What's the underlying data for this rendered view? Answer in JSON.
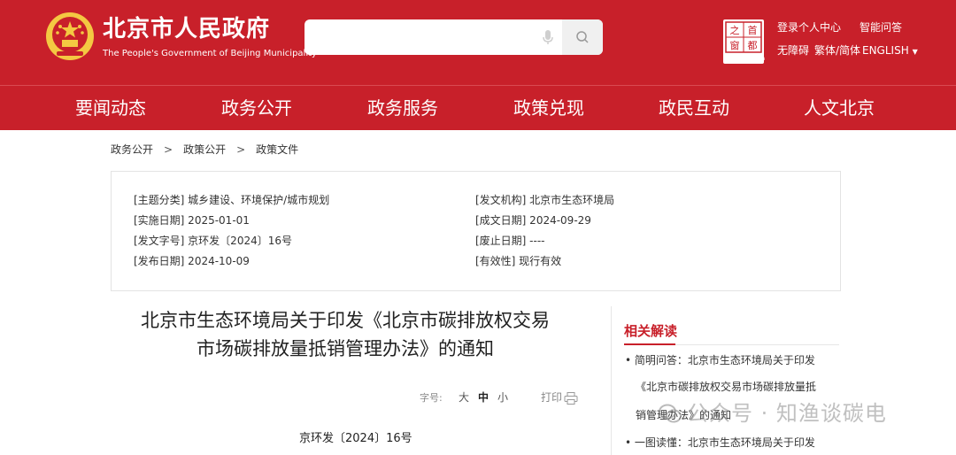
{
  "header": {
    "site_title": "北京市人民政府",
    "site_subtitle": "The People's Government of Beijing Municipality",
    "search_placeholder": "",
    "logo_chars": [
      "首",
      "都",
      "之",
      "窗"
    ],
    "logo_caption": "Beijing-China",
    "links": {
      "login": "登录个人中心",
      "smart_qa": "智能问答",
      "accessible": "无障碍",
      "traditional": "繁体/简体",
      "english": "ENGLISH"
    }
  },
  "nav": [
    "要闻动态",
    "政务公开",
    "政务服务",
    "政策兑现",
    "政民互动",
    "人文北京"
  ],
  "breadcrumb": [
    "政务公开",
    "政策公开",
    "政策文件"
  ],
  "meta": {
    "topic": "[主题分类] 城乡建设、环境保护/城市规划",
    "issuer": "[发文机构] 北京市生态环境局",
    "effective_date": "[实施日期] 2025-01-01",
    "created_date": "[成文日期] 2024-09-29",
    "doc_number": "[发文字号] 京环发〔2024〕16号",
    "repeal_date": "[废止日期] ----",
    "publish_date": "[发布日期] 2024-10-09",
    "validity": "[有效性] 现行有效"
  },
  "article": {
    "title_line1": "北京市生态环境局关于印发《北京市碳排放权交易",
    "title_line2": "市场碳排放量抵销管理办法》的通知",
    "font_size_label": "字号:",
    "font_sizes": [
      "大",
      "中",
      "小"
    ],
    "print_label": "打印",
    "doc_number": "京环发〔2024〕16号"
  },
  "related": {
    "heading": "相关解读",
    "items": [
      "• 简明问答：北京市生态环境局关于印发",
      "《北京市碳排放权交易市场碳排放量抵",
      "销管理办法》的通知",
      "• 一图读懂：北京市生态环境局关于印发"
    ]
  },
  "watermark": "公众号 · 知渔谈碳电",
  "colors": {
    "brand_red": "#c8202a",
    "emblem_gold": "#f4c842"
  }
}
